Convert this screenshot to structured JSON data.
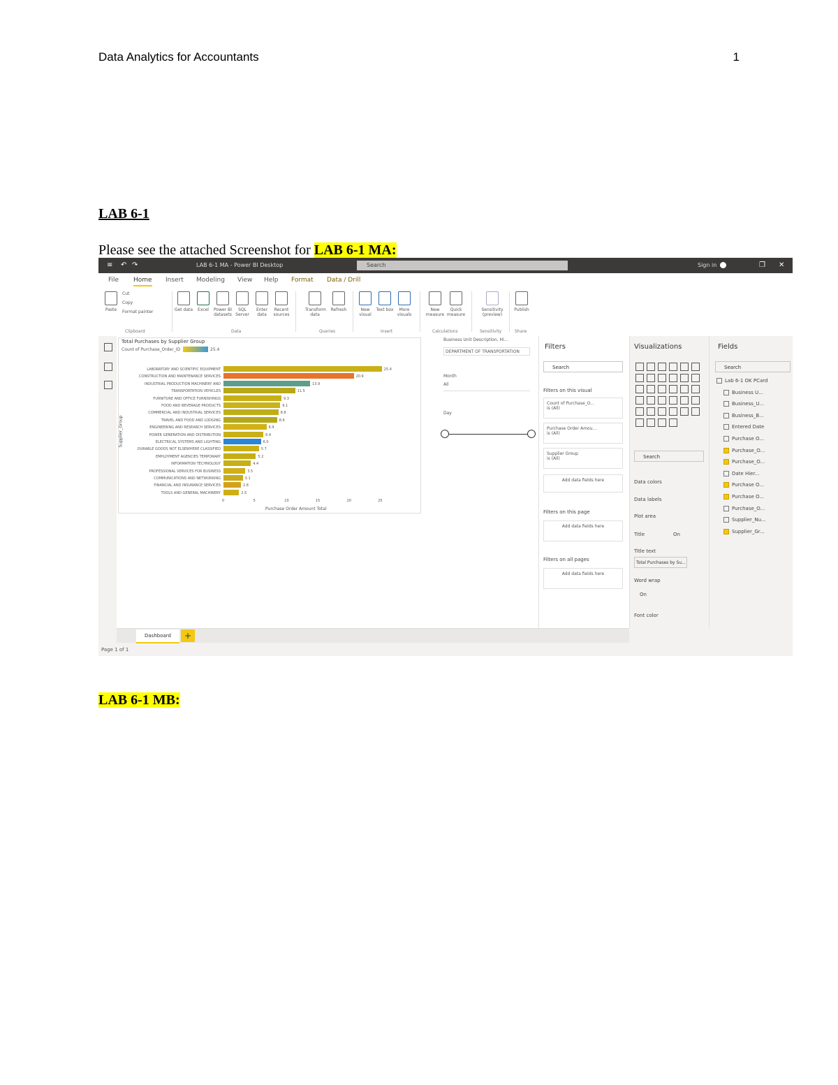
{
  "header": {
    "title": "Data Analytics for Accountants",
    "page_number": "1"
  },
  "lab_title": "LAB 6-1 ",
  "ma_line": {
    "text": "Please see the attached Screenshot for ",
    "highlight": "LAB 6-1 MA:"
  },
  "mb_label": "LAB 6-1 MB:",
  "screenshot": {
    "window_title": "LAB 6-1 MA - Power BI Desktop",
    "search_placeholder": "Search",
    "user": "Sign in",
    "tabs": [
      "File",
      "Home",
      "Insert",
      "Modeling",
      "View",
      "Help",
      "Format",
      "Data / Drill"
    ],
    "ribbon_groups": [
      "Clipboard",
      "Data",
      "Queries",
      "Insert",
      "Calculations",
      "Sensitivity",
      "Share"
    ],
    "ribbon_buttons": [
      "Paste",
      "Cut",
      "Copy",
      "Format painter",
      "Get data",
      "Excel",
      "Power BI datasets",
      "SQL Server",
      "Enter data",
      "Recent sources",
      "Transform data",
      "Refresh",
      "New visual",
      "Text box",
      "More visuals",
      "New measure",
      "Quick measure",
      "Sensitivity (preview)",
      "Publish"
    ],
    "chart_title": "Total Purchases by Supplier Group",
    "legend_label": "Count of Purchase_Order_ID",
    "y_axis_title": "Supplier_Group",
    "x_axis_title": "Purchase Order Amount Total",
    "slicer1_title": "Business Unit Description, Hi...",
    "slicer1_value": "DEPARTMENT OF TRANSPORTATION",
    "slicer2_title": "Month",
    "slicer2_value": "All",
    "slicer3_title": "Day",
    "filters": {
      "title": "Filters",
      "search": "Search",
      "visual_label": "Filters on this visual",
      "cards": [
        "Count of Purchase_O...",
        "Purchase Order Amou...",
        "Supplier Group"
      ],
      "card_value": "is (All)",
      "add_fields": "Add data fields here",
      "page_label": "Filters on this page",
      "all_pages_label": "Filters on all pages"
    },
    "viz": {
      "title": "Visualizations",
      "search": "Search",
      "options": [
        "Data colors",
        "Data labels",
        "Plot area",
        "Title",
        "Title text",
        "Word wrap",
        "Font color"
      ],
      "title_text_value": "Total Purchases by Su...",
      "on": "On"
    },
    "fields": {
      "title": "Fields",
      "search": "Search",
      "items": [
        "Lab 6-1 OK PCard",
        "Business U...",
        "Business_U...",
        "Business_B...",
        "Entered Date",
        "Purchase O...",
        "Purchase_O...",
        "Purchase_O...",
        "Date Hier...",
        "Purchase O...",
        "Purchase O...",
        "Purchase_O...",
        "Supplier_Nu...",
        "Supplier_Gr..."
      ]
    },
    "page_tab": "Dashboard",
    "status": "Page 1 of 1"
  },
  "chart_data": {
    "type": "bar",
    "title": "Total Purchases by Supplier Group",
    "xlabel": "Purchase Order Amount Total",
    "ylabel": "Supplier_Group",
    "categories": [
      "LABORATORY AND SCIENTIFIC EQUIPMENT",
      "CONSTRUCTION AND MAINTENANCE SERVICES",
      "INDUSTRIAL PRODUCTION MACHINERY AND",
      "TRANSPORTATION VEHICLES",
      "FURNITURE AND OFFICE FURNISHINGS",
      "FOOD AND BEVERAGE PRODUCTS",
      "COMMERCIAL AND INDUSTRIAL SERVICES",
      "TRAVEL AND FOOD AND LODGING",
      "ENGINEERING AND RESEARCH SERVICES",
      "POWER GENERATION AND DISTRIBUTION",
      "ELECTRICAL SYSTEMS AND LIGHTING",
      "DURABLE GOODS NOT ELSEWHERE CLASSIFIED",
      "EMPLOYMENT AGENCIES TEMPORARY",
      "INFORMATION TECHNOLOGY",
      "PROFESSIONAL SERVICES FOR BUSINESS",
      "COMMUNICATIONS AND NETWORKING",
      "FINANCIAL AND INSURANCE SERVICES",
      "TOOLS AND GENERAL MACHINERY"
    ],
    "values": [
      25.4,
      20.9,
      13.9,
      11.5,
      9.3,
      9.1,
      8.8,
      8.6,
      6.9,
      6.4,
      6.0,
      5.7,
      5.2,
      4.4,
      3.5,
      3.1,
      2.8,
      2.5
    ],
    "data_labels": [
      "25.4",
      "20.9",
      "13.9",
      "11.5",
      "9.3",
      "9.1",
      "8.8",
      "8.6",
      "6.9",
      "6.4",
      "6.0",
      "5.7",
      "5.2",
      "4.4",
      "3.5",
      "3.1",
      "2.8",
      "2.5"
    ],
    "colors": [
      "#c9b018",
      "#e8732a",
      "#5e9c8c",
      "#b8a818",
      "#c7b016",
      "#c9b318",
      "#c0ae18",
      "#b4a71a",
      "#d1b216",
      "#c9b016",
      "#2a84d8",
      "#c8b116",
      "#c4ae17",
      "#c6b016",
      "#d0b016",
      "#c8ab17",
      "#d6a01a",
      "#cfae16"
    ],
    "x_ticks": [
      "0",
      "5",
      "10",
      "15",
      "20",
      "25"
    ],
    "xlim": [
      0,
      28
    ]
  }
}
